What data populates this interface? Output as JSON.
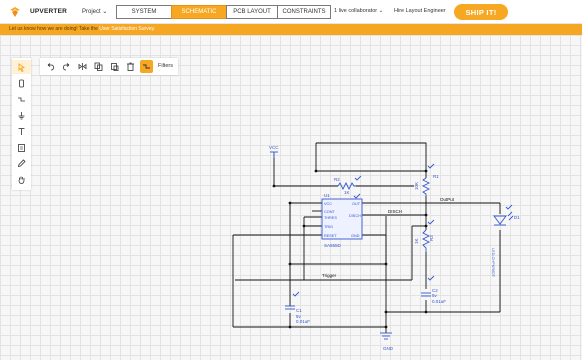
{
  "header": {
    "brand": "UPVERTER",
    "project_menu": "Project ⌄",
    "tabs": [
      {
        "label": "SYSTEM",
        "active": false
      },
      {
        "label": "SCHEMATIC",
        "active": true
      },
      {
        "label": "PCB LAYOUT",
        "active": false
      },
      {
        "label": "CONSTRAINTS",
        "active": false
      }
    ],
    "collaborators": "1 live collaborator ⌄",
    "hire": "Hire Layout Engineer",
    "ship": "SHIP IT!"
  },
  "banner": {
    "text": "Let us know how we are doing! Take the ",
    "link": "User Satisfaction Survey."
  },
  "toolbar": {
    "filters": "Filters"
  },
  "schematic": {
    "labels": {
      "vcc": "VCC",
      "gnd": "GND",
      "output": "OutPut",
      "disch": "DISCH",
      "trigger": "Trigger",
      "r2": "R2",
      "r2_val": "1K",
      "r1": "R1",
      "r1_val": "10K",
      "r3": "R3",
      "r3_val": "1K",
      "u1": "U1",
      "u1_part": "SA555D",
      "pin_vcc": "VCC",
      "pin_out": "OUT",
      "pin_cont": "CONT",
      "pin_thres": "THRES",
      "pin_disch": "DISCH",
      "pin_trig": "TRIG",
      "pin_reset": "RESET",
      "pin_gnd": "GND",
      "c1": "C1",
      "c1_v": "5v",
      "c1_val": "0.01uF",
      "c2": "C2",
      "c2_v": "5v",
      "c2_val": "0.01uF",
      "d1": "D1",
      "d1_part": "LED-CHPKR0DT"
    }
  }
}
